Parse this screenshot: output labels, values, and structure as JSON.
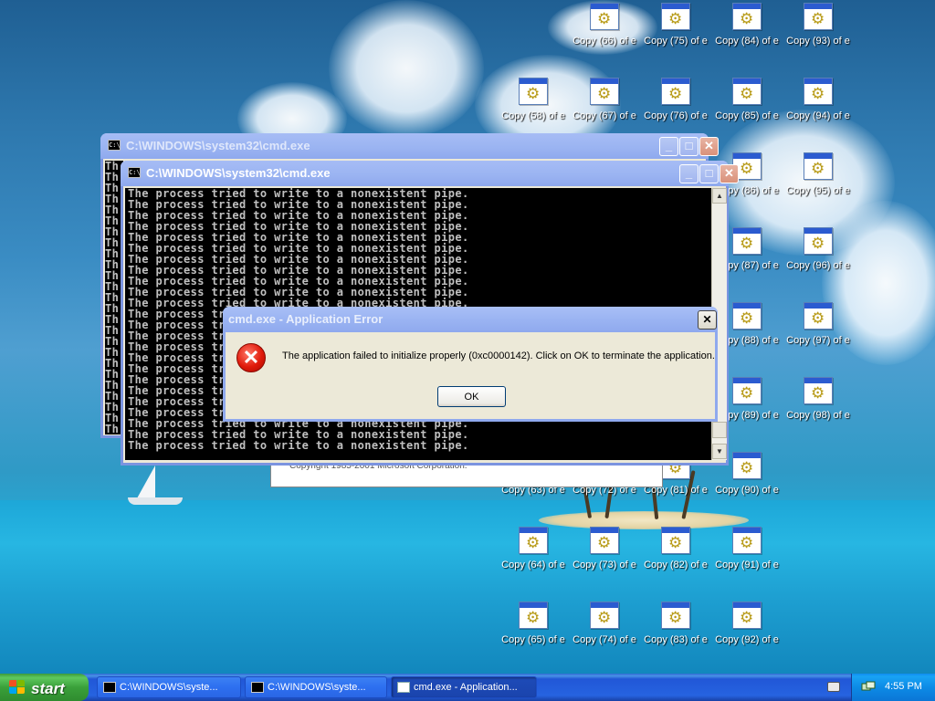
{
  "desktop": {
    "icons": [
      {
        "label": "Copy (66) of e",
        "col": 0,
        "row": 0
      },
      {
        "label": "Copy (75) of e",
        "col": 1,
        "row": 0
      },
      {
        "label": "Copy (84) of e",
        "col": 2,
        "row": 0
      },
      {
        "label": "Copy (93) of e",
        "col": 3,
        "row": 0
      },
      {
        "label": "Copy (58) of e",
        "col": -1,
        "row": 1
      },
      {
        "label": "Copy (67) of e",
        "col": 0,
        "row": 1
      },
      {
        "label": "Copy (76) of e",
        "col": 1,
        "row": 1
      },
      {
        "label": "Copy (85) of e",
        "col": 2,
        "row": 1
      },
      {
        "label": "Copy (94) of e",
        "col": 3,
        "row": 1
      },
      {
        "label": "Copy (86) of e",
        "col": 2,
        "row": 2
      },
      {
        "label": "Copy (95) of e",
        "col": 3,
        "row": 2
      },
      {
        "label": "Copy (87) of e",
        "col": 2,
        "row": 3
      },
      {
        "label": "Copy (96) of e",
        "col": 3,
        "row": 3
      },
      {
        "label": "Copy (88) of e",
        "col": 2,
        "row": 4
      },
      {
        "label": "Copy (97) of e",
        "col": 3,
        "row": 4
      },
      {
        "label": "Copy (89) of e",
        "col": 2,
        "row": 5
      },
      {
        "label": "Copy (98) of e",
        "col": 3,
        "row": 5
      },
      {
        "label": "Copy (81) of e",
        "col": 1,
        "row": 6
      },
      {
        "label": "Copy (90) of e",
        "col": 2,
        "row": 6
      },
      {
        "label": "Copy (63) of e",
        "col": -1,
        "row": 6
      },
      {
        "label": "Copy (72) of e",
        "col": 0,
        "row": 6
      },
      {
        "label": "Copy (64) of e",
        "col": -1,
        "row": 7
      },
      {
        "label": "Copy (73) of e",
        "col": 0,
        "row": 7
      },
      {
        "label": "Copy (82) of e",
        "col": 1,
        "row": 7
      },
      {
        "label": "Copy (91) of e",
        "col": 2,
        "row": 7
      },
      {
        "label": "Copy (65) of e",
        "col": -1,
        "row": 8
      },
      {
        "label": "Copy (74) of e",
        "col": 0,
        "row": 8
      },
      {
        "label": "Copy (83) of e",
        "col": 1,
        "row": 8
      },
      {
        "label": "Copy (92) of e",
        "col": 2,
        "row": 8
      }
    ]
  },
  "cmd_back": {
    "title": "C:\\WINDOWS\\system32\\cmd.exe",
    "line_prefix": "Th"
  },
  "cmd_front": {
    "title": "C:\\WINDOWS\\system32\\cmd.exe",
    "line": "The process tried to write to a nonexistent pipe.",
    "line_count": 24
  },
  "behind_window_text": "Copyright 1985-2001 Microsoft Corporation.",
  "error_dialog": {
    "title": "cmd.exe - Application Error",
    "message": "The application failed to initialize properly (0xc0000142). Click on OK to terminate the application.",
    "ok_label": "OK",
    "icon": "error-icon"
  },
  "taskbar": {
    "start_label": "start",
    "items": [
      {
        "label": "C:\\WINDOWS\\syste...",
        "icon": "console-icon",
        "active": false
      },
      {
        "label": "C:\\WINDOWS\\syste...",
        "icon": "console-icon",
        "active": false
      },
      {
        "label": "cmd.exe - Application...",
        "icon": "window-icon",
        "active": true
      }
    ],
    "clock": "4:55 PM"
  },
  "colors": {
    "titlebar_active": "#0a52e0",
    "titlebar_inactive": "#9db6f3",
    "taskbar": "#2663e0",
    "start_green": "#3aa03a",
    "tray": "#0c8be6",
    "console_bg": "#000000",
    "console_fg": "#c0c0c0",
    "error_red": "#e01a0a"
  }
}
